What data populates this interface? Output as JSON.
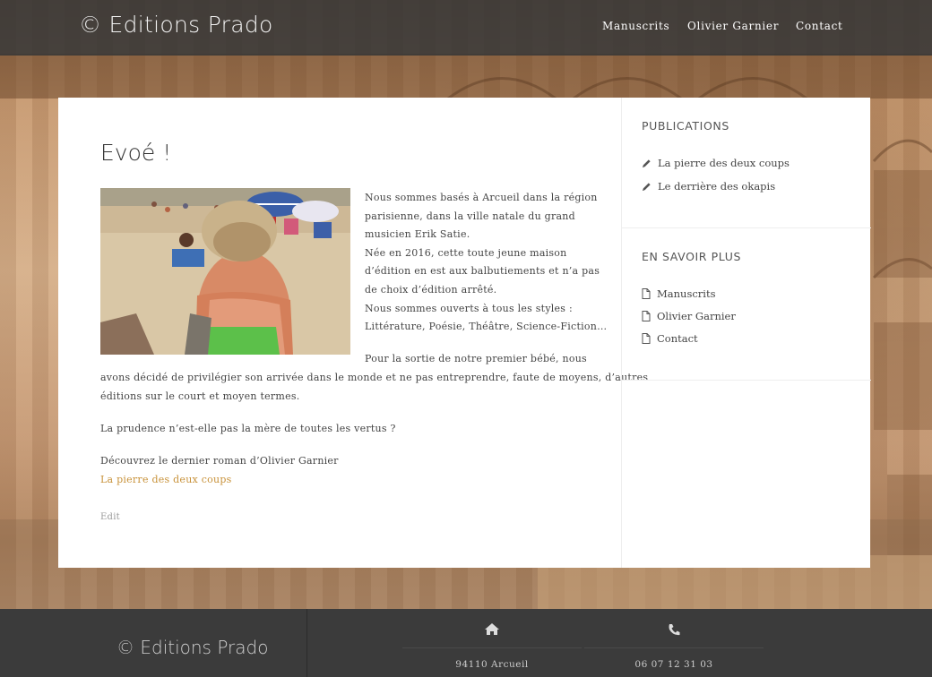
{
  "header": {
    "brand": "© Editions Prado",
    "nav": [
      "Manuscrits",
      "Olivier Garnier",
      "Contact"
    ]
  },
  "article": {
    "title": "Evoé !",
    "wrapped_lines": [
      "Nous sommes basés à Arcueil dans la région",
      "parisienne, dans la ville natale du grand",
      "musicien Erik Satie.",
      "Née en 2016, cette toute jeune maison",
      "d’édition en est aux balbutiements et n’a pas",
      "de choix d’édition arrêté.",
      "Nous sommes ouverts à tous les styles :",
      "Littérature, Poésie, Théâtre, Science-Fiction…",
      "Pour la sortie de notre premier bébé, nous"
    ],
    "full_lines": [
      "avons décidé de privilégier son arrivée dans le monde et ne pas entreprendre, faute de moyens, d’autres",
      "éditions sur le court et moyen termes."
    ],
    "prudence": "La prudence n’est-elle pas la mère de toutes les vertus ?",
    "discover": "Découvrez le dernier roman d’Olivier Garnier",
    "book_link": "La pierre des deux coups",
    "edit": "Edit"
  },
  "sidebar": {
    "publications_title": "PUBLICATIONS",
    "publications": [
      "La pierre des deux coups",
      "Le derrière des okapis"
    ],
    "more_title": "EN SAVOIR PLUS",
    "more": [
      "Manuscrits",
      "Olivier Garnier",
      "Contact"
    ]
  },
  "footer": {
    "brand": "© Editions Prado",
    "address": "94110 Arcueil",
    "phone": "06 07 12 31 03"
  },
  "icons": {
    "publication_item": "pencil-icon",
    "more_item": "file-icon",
    "address": "home-icon",
    "phone": "phone-icon"
  },
  "colors": {
    "link": "#c8923a",
    "header_bg": "#373737",
    "footer_bg": "#3b3b3b"
  }
}
